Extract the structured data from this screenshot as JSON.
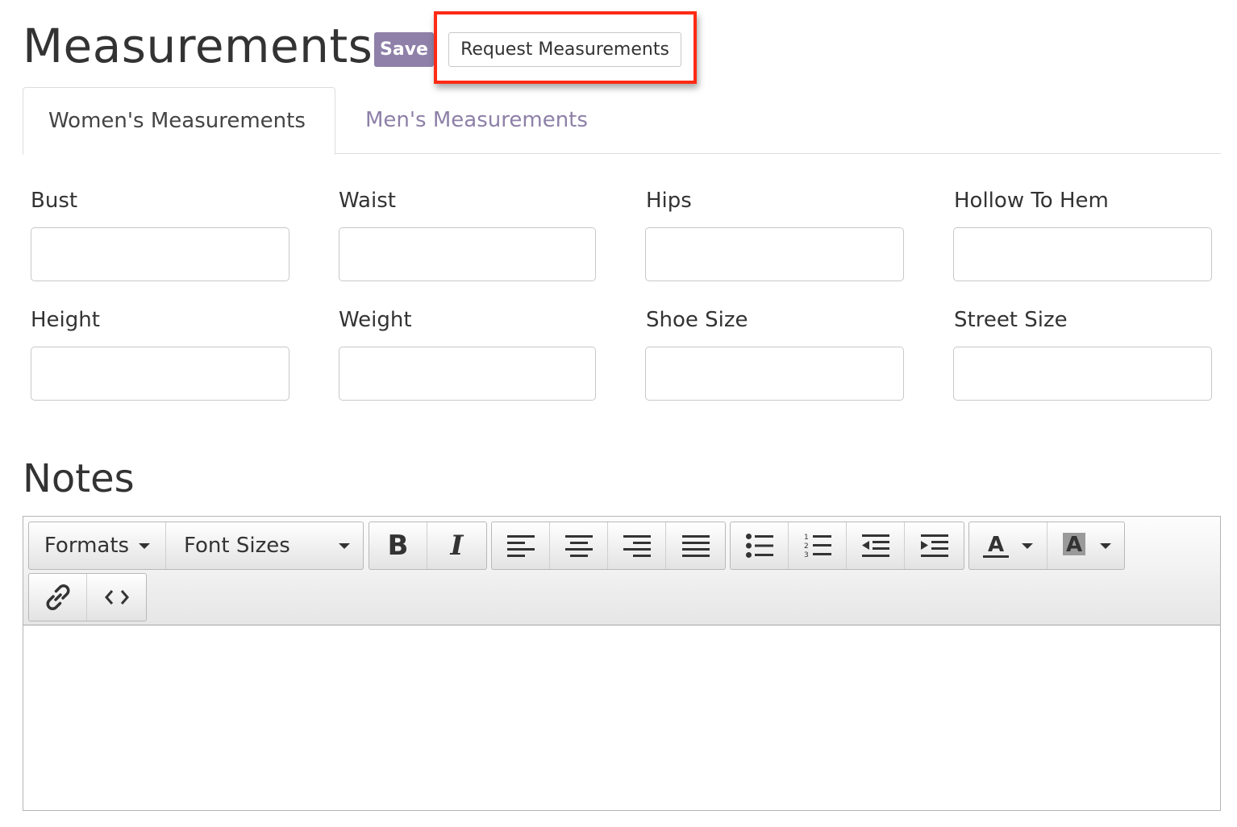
{
  "header": {
    "title": "Measurements",
    "save_label": "Save",
    "request_label": "Request Measurements"
  },
  "tabs": [
    {
      "label": "Women's Measurements",
      "active": true
    },
    {
      "label": "Men's Measurements",
      "active": false
    }
  ],
  "fields": [
    {
      "label": "Bust",
      "value": ""
    },
    {
      "label": "Waist",
      "value": ""
    },
    {
      "label": "Hips",
      "value": ""
    },
    {
      "label": "Hollow To Hem",
      "value": ""
    },
    {
      "label": "Height",
      "value": ""
    },
    {
      "label": "Weight",
      "value": ""
    },
    {
      "label": "Shoe Size",
      "value": ""
    },
    {
      "label": "Street Size",
      "value": ""
    }
  ],
  "notes": {
    "title": "Notes",
    "toolbar": {
      "formats_label": "Formats",
      "font_sizes_label": "Font Sizes",
      "buttons": [
        "bold-icon",
        "italic-icon",
        "align-left-icon",
        "align-center-icon",
        "align-right-icon",
        "align-justify-icon",
        "bullet-list-icon",
        "numbered-list-icon",
        "outdent-icon",
        "indent-icon",
        "text-color-icon",
        "background-color-icon",
        "link-icon",
        "source-code-icon"
      ]
    },
    "content": ""
  },
  "colors": {
    "accent": "#8e80a8",
    "highlight": "#ff2a14",
    "text": "#333333",
    "border": "#c8c8c8"
  }
}
